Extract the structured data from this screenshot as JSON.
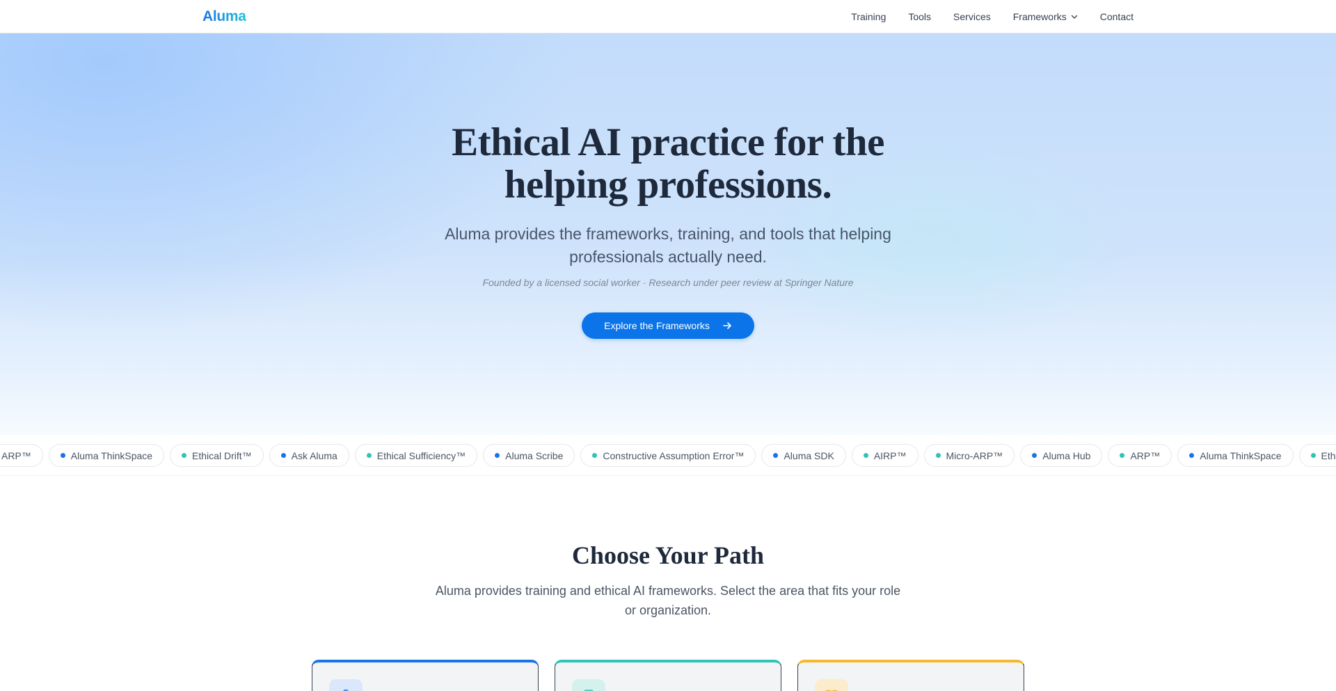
{
  "nav": {
    "logo": "Aluma",
    "links": [
      "Training",
      "Tools",
      "Services",
      "Frameworks",
      "Contact"
    ]
  },
  "hero": {
    "title_line1": "Ethical AI practice for the",
    "title_line2": "helping professions.",
    "subtitle": "Aluma provides the frameworks, training, and tools that helping professionals actually need.",
    "note": "Founded by a licensed social worker · Research under peer review at Springer Nature",
    "cta_label": "Explore the Frameworks"
  },
  "ticker": {
    "items": [
      {
        "label": "ARP™",
        "dot": "teal"
      },
      {
        "label": "Aluma ThinkSpace",
        "dot": "blue"
      },
      {
        "label": "Ethical Drift™",
        "dot": "teal"
      },
      {
        "label": "Ask Aluma",
        "dot": "blue"
      },
      {
        "label": "Ethical Sufficiency™",
        "dot": "teal"
      },
      {
        "label": "Aluma Scribe",
        "dot": "blue"
      },
      {
        "label": "Constructive Assumption Error™",
        "dot": "teal"
      },
      {
        "label": "Aluma SDK",
        "dot": "blue"
      },
      {
        "label": "AIRP™",
        "dot": "teal"
      },
      {
        "label": "Micro-ARP™",
        "dot": "teal"
      },
      {
        "label": "Aluma Hub",
        "dot": "blue"
      },
      {
        "label": "ARP™",
        "dot": "teal"
      },
      {
        "label": "Aluma ThinkSpace",
        "dot": "blue"
      },
      {
        "label": "Ethical Drift™",
        "dot": "teal"
      }
    ]
  },
  "path": {
    "title": "Choose Your Path",
    "subtitle": "Aluma provides training and ethical AI frameworks. Select the area that fits your role or organization."
  },
  "colors": {
    "accent_blue": "#1a73e8",
    "accent_teal": "#2ec4b6",
    "accent_amber": "#f5b82e",
    "cta": "#0a74e8"
  }
}
